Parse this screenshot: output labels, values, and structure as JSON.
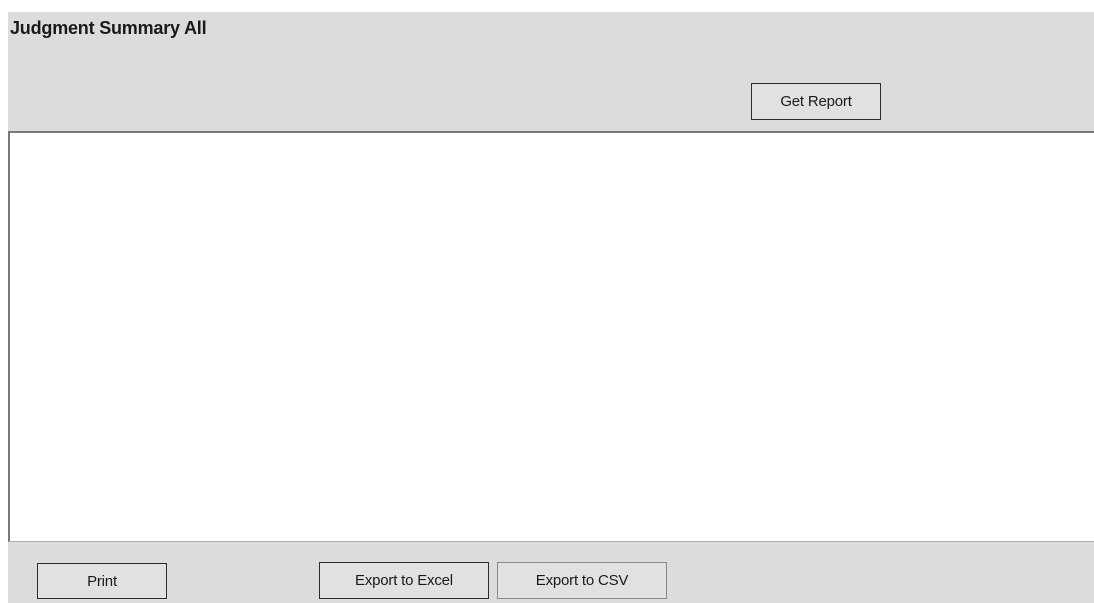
{
  "window": {
    "title": "Judgment Summary All"
  },
  "toolbar": {
    "get_report_label": "Get Report"
  },
  "report": {
    "content": ""
  },
  "footer": {
    "print_label": "Print",
    "export_excel_label": "Export to Excel",
    "export_csv_label": "Export to CSV"
  },
  "colors": {
    "panel_background": "#dcdcdc",
    "report_background": "#ffffff",
    "button_background": "#e1e1e1"
  }
}
